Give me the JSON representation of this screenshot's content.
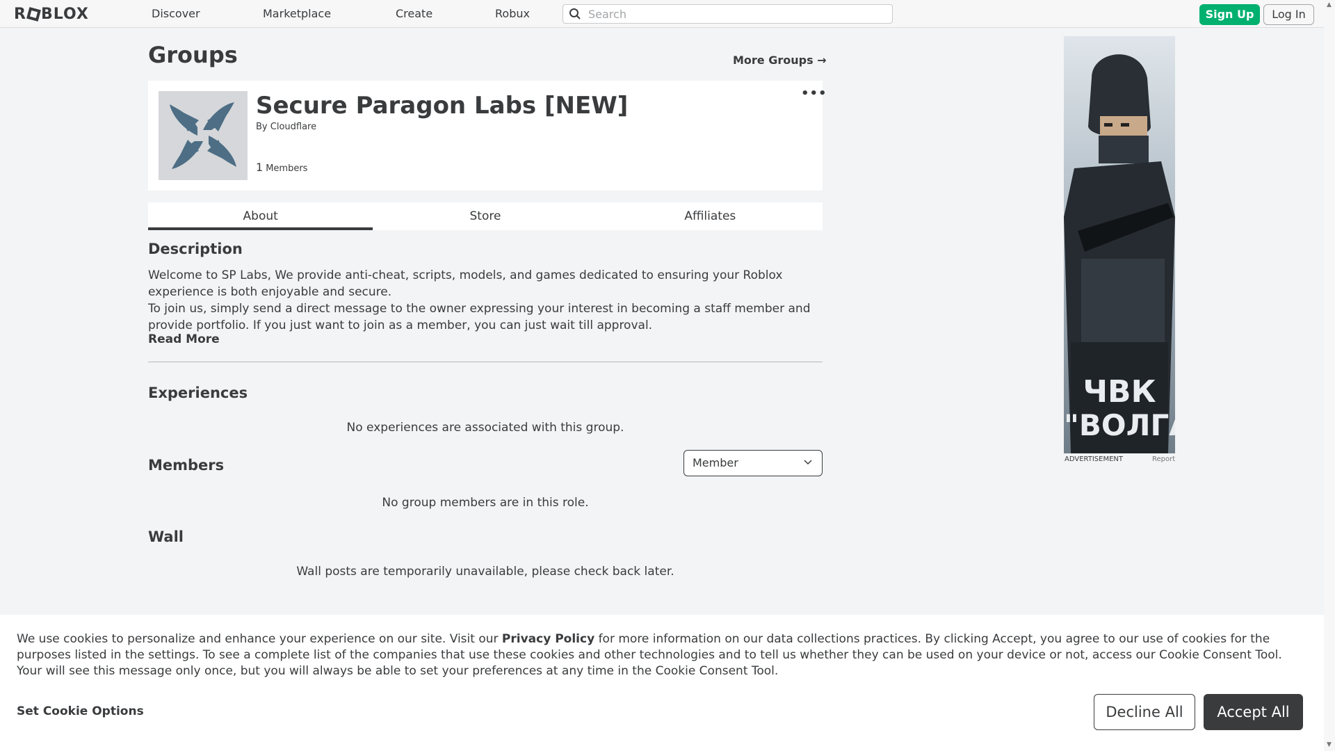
{
  "nav": {
    "logo": "ROBLOX",
    "links": [
      "Discover",
      "Marketplace",
      "Create",
      "Robux"
    ],
    "search_placeholder": "Search",
    "signup": "Sign Up",
    "login": "Log In"
  },
  "page": {
    "title": "Groups",
    "more_groups": "More Groups →"
  },
  "group": {
    "name": "Secure Paragon Labs [NEW]",
    "by_label": "By",
    "owner": "Cloudflare",
    "member_count": "1",
    "members_label": "Members",
    "more_icon": "ellipsis-icon"
  },
  "tabs": [
    "About",
    "Store",
    "Affiliates"
  ],
  "about": {
    "description_heading": "Description",
    "description_line1": "Welcome to SP Labs, We provide anti-cheat, scripts, models, and games dedicated to ensuring your Roblox experience is both enjoyable and secure.",
    "description_line2": "To join us, simply send a direct message to the owner expressing your interest in becoming a staff member and provide portfolio. If you just want to join as a member, you can just wait till approval.",
    "read_more": "Read More",
    "experiences_heading": "Experiences",
    "experiences_empty": "No experiences are associated with this group.",
    "members_heading": "Members",
    "role_selected": "Member",
    "members_empty": "No group members are in this role.",
    "wall_heading": "Wall",
    "wall_msg": "Wall posts are temporarily unavailable, please check back later."
  },
  "ad": {
    "text_line1": "ЧВК",
    "text_line2": "\"ВОЛГА\"",
    "label": "ADVERTISEMENT",
    "report": "Report"
  },
  "cookie": {
    "text_before": "We use cookies to personalize and enhance your experience on our site. Visit our ",
    "privacy_link": "Privacy Policy",
    "text_after": " for more information on our data collections practices. By clicking Accept, you agree to our use of cookies for the purposes listed in the settings. To see a complete list of the companies that use these cookies and other technologies and to tell us whether they can be used on your device or not, access our Cookie Consent Tool. Your will see this message only once, but you will always be able to set your preferences at any time in the Cookie Consent Tool.",
    "set_options": "Set Cookie Options",
    "decline": "Decline All",
    "accept": "Accept All"
  },
  "colors": {
    "signup_green": "#00b06f",
    "text": "#393b3d",
    "background": "#f2f4f5"
  }
}
